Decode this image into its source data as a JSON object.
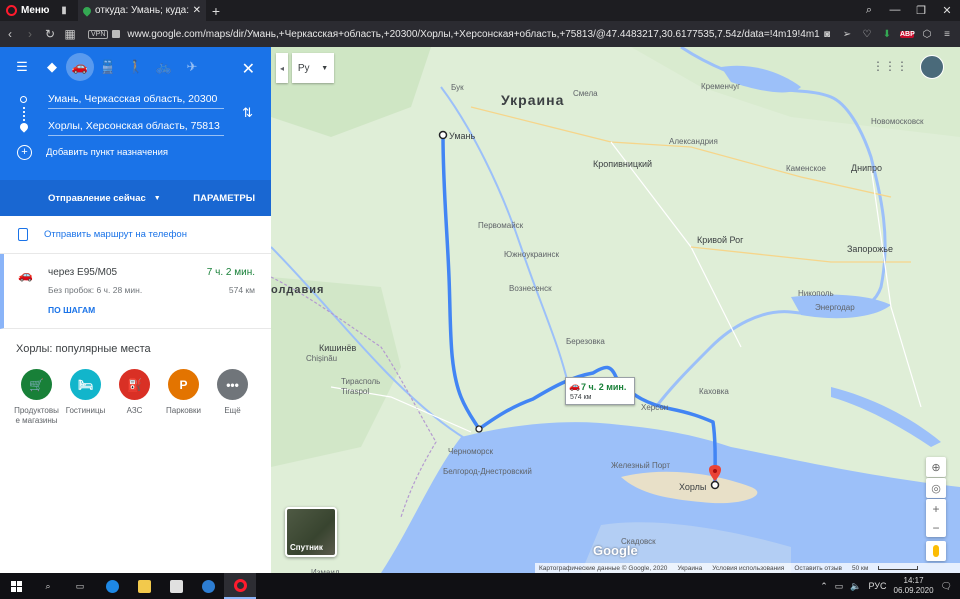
{
  "browser": {
    "menu_label": "Меню",
    "tab_title": "откуда: Умань; куда: Хорл",
    "url": "www.google.com/maps/dir/Умань,+Черкасская+область,+20300/Хорлы,+Херсонская+область,+75813/@47.4483217,30.6177535,7.54z/data=!4m19!4m1",
    "vpn_label": "VPN",
    "abp_label": "ABP",
    "icons": [
      "back-icon",
      "forward-icon",
      "reload-icon",
      "speed-dial-icon",
      "camera-icon",
      "send-icon",
      "heart-icon",
      "download-icon",
      "adblock-icon",
      "cube-icon",
      "settings-icon"
    ]
  },
  "sidebar": {
    "modes": [
      "directions-icon",
      "car-icon",
      "transit-icon",
      "walk-icon",
      "bicycle-icon",
      "flight-icon"
    ],
    "origin": "Умань, Черкасская область, 20300",
    "destination": "Хорлы, Херсонская область, 75813",
    "add_destination": "Добавить пункт назначения",
    "departure": "Отправление сейчас",
    "params": "ПАРАМЕТРЫ",
    "send_to_phone": "Отправить маршрут на телефон",
    "route": {
      "via": "через E95/M05",
      "duration": "7 ч. 2 мин.",
      "no_traffic": "Без пробок: 6 ч. 28 мин.",
      "distance": "574 км",
      "steps": "ПО ШАГАМ"
    },
    "popular_title": "Хорлы: популярные места",
    "places": [
      {
        "label": "Продуктовы е магазины",
        "color": "#188038",
        "glyph": "🛒"
      },
      {
        "label": "Гостиницы",
        "color": "#12b5cb",
        "glyph": "🛏"
      },
      {
        "label": "АЗС",
        "color": "#d93025",
        "glyph": "⛽"
      },
      {
        "label": "Парковки",
        "color": "#e37400",
        "glyph": "P"
      },
      {
        "label": "Ещё",
        "color": "#70757a",
        "glyph": "•••"
      }
    ]
  },
  "map": {
    "lang_label": "Ру",
    "country": "Украина",
    "moldova": "олдавия",
    "callout": {
      "duration": "7 ч. 2 мин.",
      "distance": "574 км"
    },
    "satellite_label": "Спутник",
    "google": "Google",
    "attribution": [
      "Картографические данные © Google, 2020",
      "Украина",
      "Условия использования",
      "Оставить отзыв",
      "50 км"
    ],
    "cities": [
      {
        "name": "Умань",
        "cls": "city"
      },
      {
        "name": "Смела",
        "cls": ""
      },
      {
        "name": "Кременчуг",
        "cls": ""
      },
      {
        "name": "Кропивницкий",
        "cls": "city"
      },
      {
        "name": "Александрия",
        "cls": ""
      },
      {
        "name": "Каменское",
        "cls": ""
      },
      {
        "name": "Днипро",
        "cls": "city"
      },
      {
        "name": "Первомайск",
        "cls": ""
      },
      {
        "name": "Кривой Рог",
        "cls": "city"
      },
      {
        "name": "Запорожье",
        "cls": "city"
      },
      {
        "name": "Южноукраинск",
        "cls": ""
      },
      {
        "name": "Никополь",
        "cls": ""
      },
      {
        "name": "Вознесенск",
        "cls": ""
      },
      {
        "name": "Энергодар",
        "cls": ""
      },
      {
        "name": "Кишинёв",
        "cls": "city"
      },
      {
        "name": "Chișinău",
        "cls": ""
      },
      {
        "name": "Тирасполь",
        "cls": ""
      },
      {
        "name": "Tiraspol",
        "cls": ""
      },
      {
        "name": "Херсон",
        "cls": ""
      },
      {
        "name": "Каховка",
        "cls": ""
      },
      {
        "name": "Черноморск",
        "cls": ""
      },
      {
        "name": "Белгород-Днестровский",
        "cls": ""
      },
      {
        "name": "Хорлы",
        "cls": "city"
      },
      {
        "name": "Железный Порт",
        "cls": ""
      },
      {
        "name": "Измаил",
        "cls": ""
      },
      {
        "name": "Бук",
        "cls": ""
      },
      {
        "name": "Новомосковск",
        "cls": ""
      },
      {
        "name": "Березовка",
        "cls": ""
      },
      {
        "name": "Скадовск",
        "cls": ""
      }
    ]
  },
  "taskbar": {
    "lang": "РУС",
    "time": "14:17",
    "date": "06.09.2020"
  }
}
